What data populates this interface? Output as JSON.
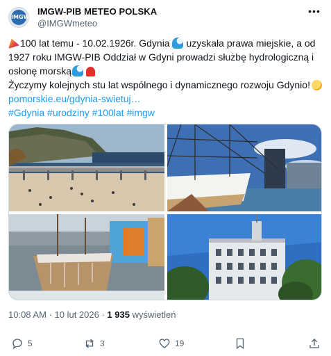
{
  "author": {
    "name": "IMGW-PIB METEO POLSKA",
    "handle": "@IMGWmeteo",
    "avatar_text": "IMGW"
  },
  "tweet": {
    "line1_text": "100 lat temu - 10.02.1926r. Gdynia",
    "line1_text_b": " uzyskała prawa miejskie, a od",
    "line2_text": "1927 roku IMGW-PIB Oddział w Gdyni prowadzi służbę hydrologiczną i",
    "line3_text": "osłonę morską",
    "line4_text": "Życzymy kolejnych stu lat wspólnego i dynamicznego rozwoju Gdynio!",
    "link": "pomorskie.eu/gdynia-swietuj…",
    "hashtags": "#Gdynia #urodziny #100lat #imgw"
  },
  "emoji": {
    "party": "party-popper-emoji",
    "wave": "water-wave-emoji",
    "light": "rotating-light-emoji",
    "clap": "clapping-hands-emoji"
  },
  "media": [
    {
      "name": "photo-gdynia-beach-pier"
    },
    {
      "name": "photo-sailing-ship-dar-pomorza"
    },
    {
      "name": "photo-icy-boat-harbor"
    },
    {
      "name": "photo-imgw-building-tower"
    }
  ],
  "meta": {
    "time": "10:08 AM",
    "sep": " · ",
    "date": "10 lut 2026",
    "sep2": " · ",
    "views": "1 935",
    "views_label": " wyświetleń"
  },
  "actions": {
    "replies": "5",
    "retweets": "3",
    "likes": "19"
  },
  "colors": {
    "link": "#1d9bf0",
    "muted": "#536471",
    "text": "#0f1419"
  }
}
